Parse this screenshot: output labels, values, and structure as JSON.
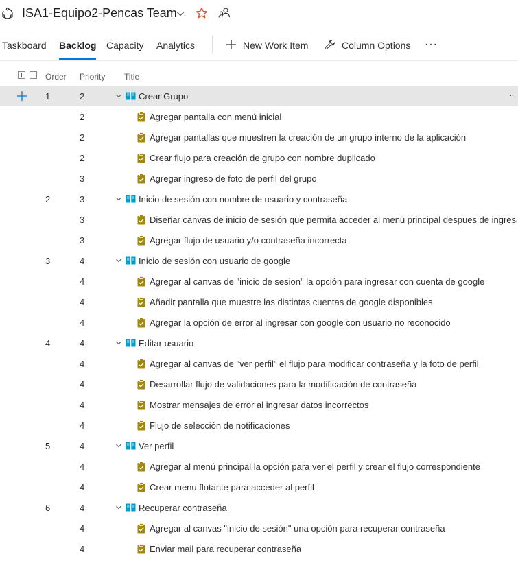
{
  "header": {
    "team_title": "ISA1-Equipo2-Pencas Team"
  },
  "toolbar": {
    "tabs": [
      {
        "label": "Taskboard"
      },
      {
        "label": "Backlog"
      },
      {
        "label": "Capacity"
      },
      {
        "label": "Analytics"
      }
    ],
    "new_item_label": "New Work Item",
    "column_options_label": "Column Options",
    "more_label": "···"
  },
  "columns": {
    "order": "Order",
    "priority": "Priority",
    "title": "Title"
  },
  "colors": {
    "accent": "#0078d4",
    "story_icon": "#009ccc",
    "task_icon": "#a4880a",
    "selected_row": "#e6e6e6"
  },
  "rows": [
    {
      "type": "story",
      "order": "1",
      "priority": "2",
      "title": "Crear Grupo",
      "selected": true
    },
    {
      "type": "task",
      "order": "",
      "priority": "2",
      "title": "Agregar pantalla con menú inicial"
    },
    {
      "type": "task",
      "order": "",
      "priority": "2",
      "title": "Agregar pantallas que muestren la creación de un grupo interno de la aplicación"
    },
    {
      "type": "task",
      "order": "",
      "priority": "2",
      "title": "Crear flujo para creación de grupo con nombre duplicado"
    },
    {
      "type": "task",
      "order": "",
      "priority": "3",
      "title": "Agregar ingreso de foto de perfil del grupo"
    },
    {
      "type": "story",
      "order": "2",
      "priority": "3",
      "title": "Inicio de sesión con nombre de usuario y contraseña"
    },
    {
      "type": "task",
      "order": "",
      "priority": "3",
      "title": "Diseñar canvas de inicio de sesión que permita acceder al menú principal despues de ingresa..."
    },
    {
      "type": "task",
      "order": "",
      "priority": "3",
      "title": "Agregar flujo de usuario y/o contraseña incorrecta"
    },
    {
      "type": "story",
      "order": "3",
      "priority": "4",
      "title": "Inicio de sesión con usuario de google"
    },
    {
      "type": "task",
      "order": "",
      "priority": "4",
      "title": "Agregar al canvas de \"inicio de sesion\" la opción para ingresar con cuenta de google"
    },
    {
      "type": "task",
      "order": "",
      "priority": "4",
      "title": "Añadir pantalla que muestre las distintas cuentas de google disponibles"
    },
    {
      "type": "task",
      "order": "",
      "priority": "4",
      "title": "Agregar la opción de error al ingresar con google con usuario no reconocido"
    },
    {
      "type": "story",
      "order": "4",
      "priority": "4",
      "title": "Editar usuario"
    },
    {
      "type": "task",
      "order": "",
      "priority": "4",
      "title": "Agregar al canvas de \"ver perfil\" el flujo para modificar contraseña y la foto de perfil"
    },
    {
      "type": "task",
      "order": "",
      "priority": "4",
      "title": "Desarrollar flujo de validaciones para la modificación de contraseña"
    },
    {
      "type": "task",
      "order": "",
      "priority": "4",
      "title": "Mostrar mensajes de error al ingresar datos incorrectos"
    },
    {
      "type": "task",
      "order": "",
      "priority": "4",
      "title": "Flujo de selección de notificaciones"
    },
    {
      "type": "story",
      "order": "5",
      "priority": "4",
      "title": "Ver perfil"
    },
    {
      "type": "task",
      "order": "",
      "priority": "4",
      "title": "Agregar al menú principal la opción para ver el perfil y crear el flujo correspondiente"
    },
    {
      "type": "task",
      "order": "",
      "priority": "4",
      "title": "Crear menu flotante para acceder al perfil"
    },
    {
      "type": "story",
      "order": "6",
      "priority": "4",
      "title": "Recuperar contraseña"
    },
    {
      "type": "task",
      "order": "",
      "priority": "4",
      "title": "Agregar al canvas \"inicio de sesión\" una opción para recuperar contraseña"
    },
    {
      "type": "task",
      "order": "",
      "priority": "4",
      "title": "Enviar mail para recuperar contraseña"
    }
  ]
}
